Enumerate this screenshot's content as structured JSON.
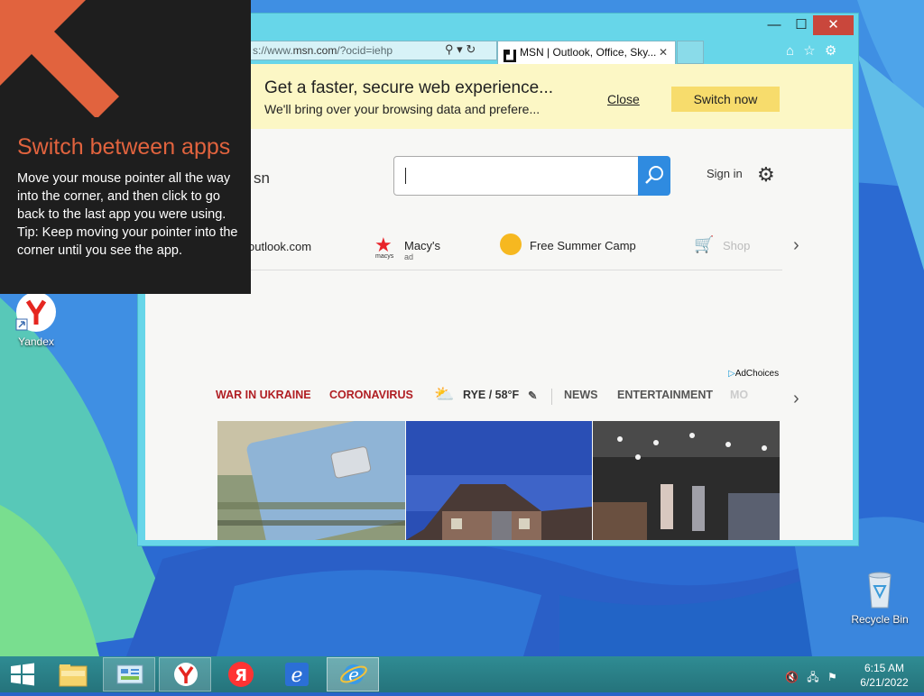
{
  "desktop": {
    "icons": [
      {
        "label": "Yandex"
      },
      {
        "label": "Recycle Bin"
      }
    ]
  },
  "ie": {
    "address": {
      "prefix": "s://www.",
      "domain": "msn.com",
      "path": "/?ocid=iehp"
    },
    "tab_title": "MSN | Outlook, Office, Sky...",
    "window_controls": {
      "minimize": "—",
      "maximize": "☐",
      "close": "✕"
    },
    "right_icons": [
      "home-icon",
      "favorites-icon",
      "tools-icon"
    ]
  },
  "notification": {
    "title": "Get a faster, secure web experience...",
    "subtitle": "We'll bring over your browsing data and prefere...",
    "close_label": "Close",
    "switch_label": "Switch now"
  },
  "msn": {
    "logo": "sn",
    "signin": "Sign in",
    "quicklinks": {
      "outlook": "outlook.com",
      "macys": "Macy's",
      "macys_ad": "ad",
      "macys_small": "macys",
      "camp": "Free Summer Camp",
      "shop": "Shop"
    },
    "adchoices": "AdChoices",
    "nav": {
      "war": "WAR IN UKRAINE",
      "corona": "CORONAVIRUS",
      "weather": "RYE / 58°F",
      "news": "NEWS",
      "entertainment": "ENTERTAINMENT",
      "more": "MO"
    }
  },
  "tip": {
    "title": "Switch between apps",
    "body_lines": [
      "Move your mouse pointer all the way into the corner, and then click to go back to the last app you were using.",
      "Tip: Keep moving your pointer into the corner until you see the app."
    ]
  },
  "taskbar": {
    "apps": [
      "start",
      "file-explorer",
      "control-panel",
      "yandex-browser",
      "yandex",
      "internet-explorer",
      "internet-explorer-active"
    ],
    "time": "6:15 AM",
    "date": "6/21/2022"
  },
  "colors": {
    "accent_orange": "#e1633e",
    "window_frame": "#67d6e9",
    "notif_bg": "#fcf7c5",
    "search_btn": "#2f8be0",
    "nav_red": "#b01e23"
  }
}
